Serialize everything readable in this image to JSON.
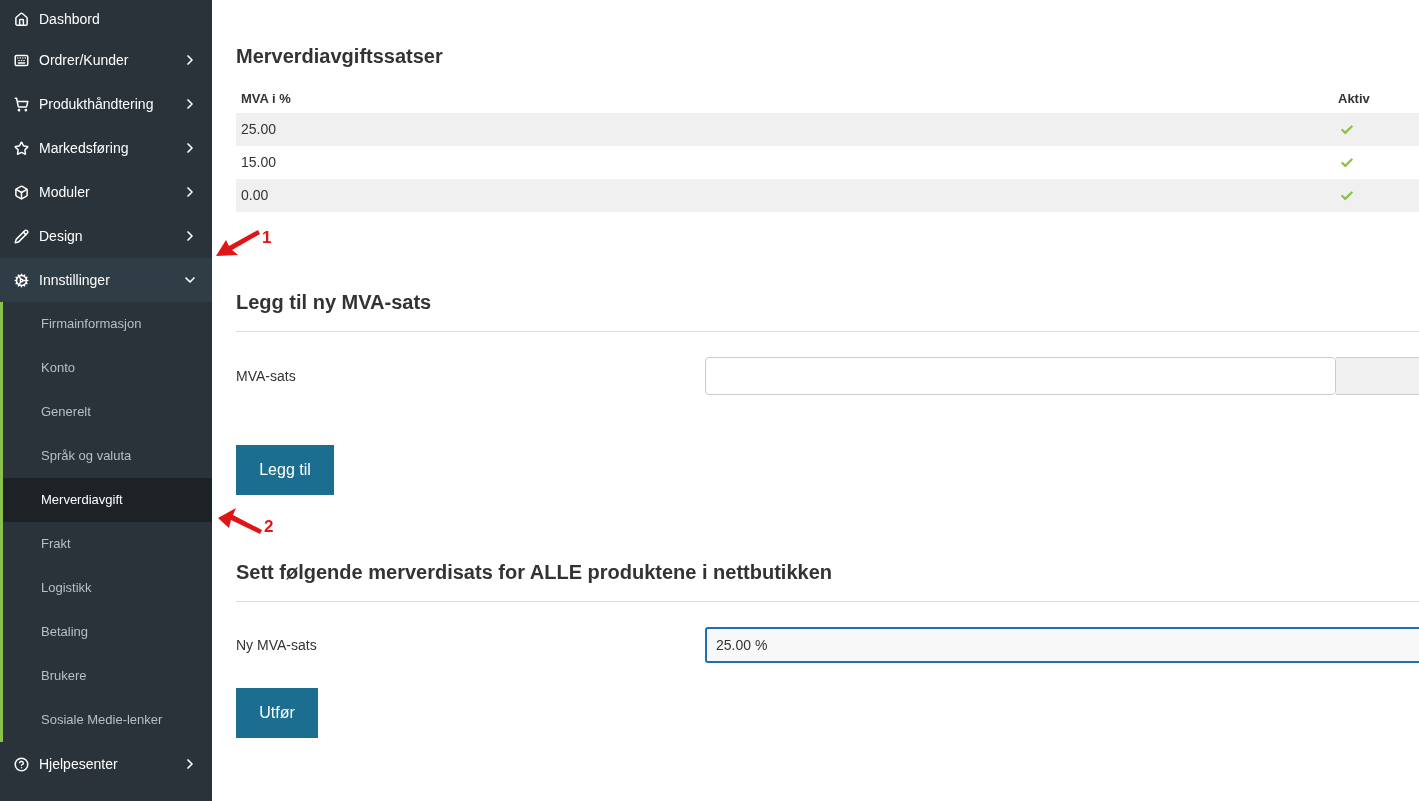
{
  "sidebar": {
    "items": [
      {
        "label": "Dashbord",
        "kind": "link"
      },
      {
        "label": "Ordrer/Kunder",
        "kind": "group",
        "expanded": false
      },
      {
        "label": "Produkthåndtering",
        "kind": "group",
        "expanded": false
      },
      {
        "label": "Markedsføring",
        "kind": "group",
        "expanded": false
      },
      {
        "label": "Moduler",
        "kind": "group",
        "expanded": false
      },
      {
        "label": "Design",
        "kind": "group",
        "expanded": false
      },
      {
        "label": "Innstillinger",
        "kind": "group",
        "expanded": true,
        "children": [
          {
            "label": "Firmainformasjon",
            "selected": false
          },
          {
            "label": "Konto",
            "selected": false
          },
          {
            "label": "Generelt",
            "selected": false
          },
          {
            "label": "Språk og valuta",
            "selected": false
          },
          {
            "label": "Merverdiavgift",
            "selected": true
          },
          {
            "label": "Frakt",
            "selected": false
          },
          {
            "label": "Logistikk",
            "selected": false
          },
          {
            "label": "Betaling",
            "selected": false
          },
          {
            "label": "Brukere",
            "selected": false
          },
          {
            "label": "Sosiale Medie-lenker",
            "selected": false
          }
        ]
      },
      {
        "label": "Hjelpesenter",
        "kind": "group",
        "expanded": false
      }
    ]
  },
  "rates": {
    "title": "Merverdiavgiftssatser",
    "columns": [
      "MVA i %",
      "Aktiv"
    ],
    "rows": [
      {
        "rate": "25.00",
        "active": true
      },
      {
        "rate": "15.00",
        "active": true
      },
      {
        "rate": "0.00",
        "active": true
      }
    ]
  },
  "add_form": {
    "title": "Legg til ny MVA-sats",
    "field_label": "MVA-sats",
    "button": "Legg til"
  },
  "apply_form": {
    "title": "Sett følgende merverdisats for ALLE produktene i nettbutikken",
    "field_label": "Ny MVA-sats",
    "value": "25.00 %",
    "button": "Utfør"
  },
  "annotations": [
    {
      "label": "1"
    },
    {
      "label": "2"
    }
  ]
}
